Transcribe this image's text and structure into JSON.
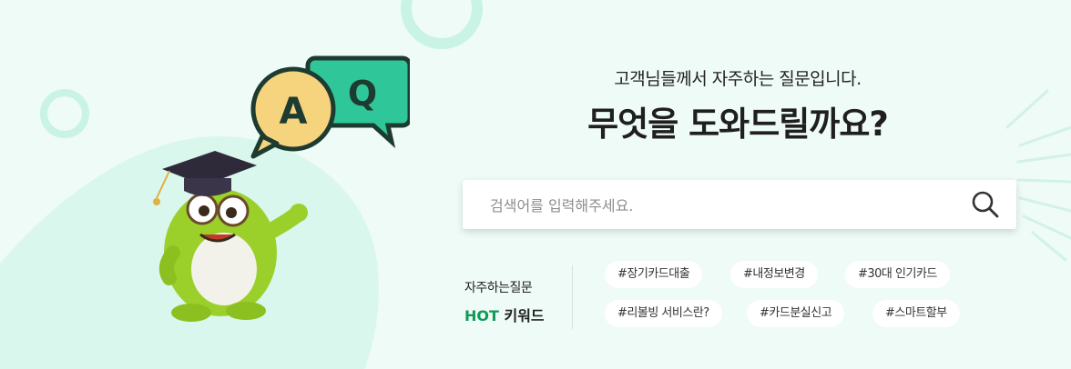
{
  "header": {
    "subtitle": "고객님들께서 자주하는 질문입니다.",
    "title": "무엇을 도와드릴까요?"
  },
  "mascot": {
    "bubble_a": "A",
    "bubble_q": "Q"
  },
  "search": {
    "placeholder": "검색어를 입력해주세요.",
    "value": "",
    "button_icon": "search-icon"
  },
  "hot_keywords": {
    "label_line1": "자주하는질문",
    "label_hot": "HOT",
    "label_rest": " 키워드",
    "items": [
      "#장기카드대출",
      "#내정보변경",
      "#30대 인기카드",
      "#리볼빙 서비스란?",
      "#카드분실신고",
      "#스마트할부"
    ]
  },
  "colors": {
    "background": "#eefbf6",
    "accent_green": "#0e9a59",
    "bubble_q": "#2fc79a",
    "bubble_a": "#f6d37d",
    "mascot_body": "#9bd02b"
  }
}
